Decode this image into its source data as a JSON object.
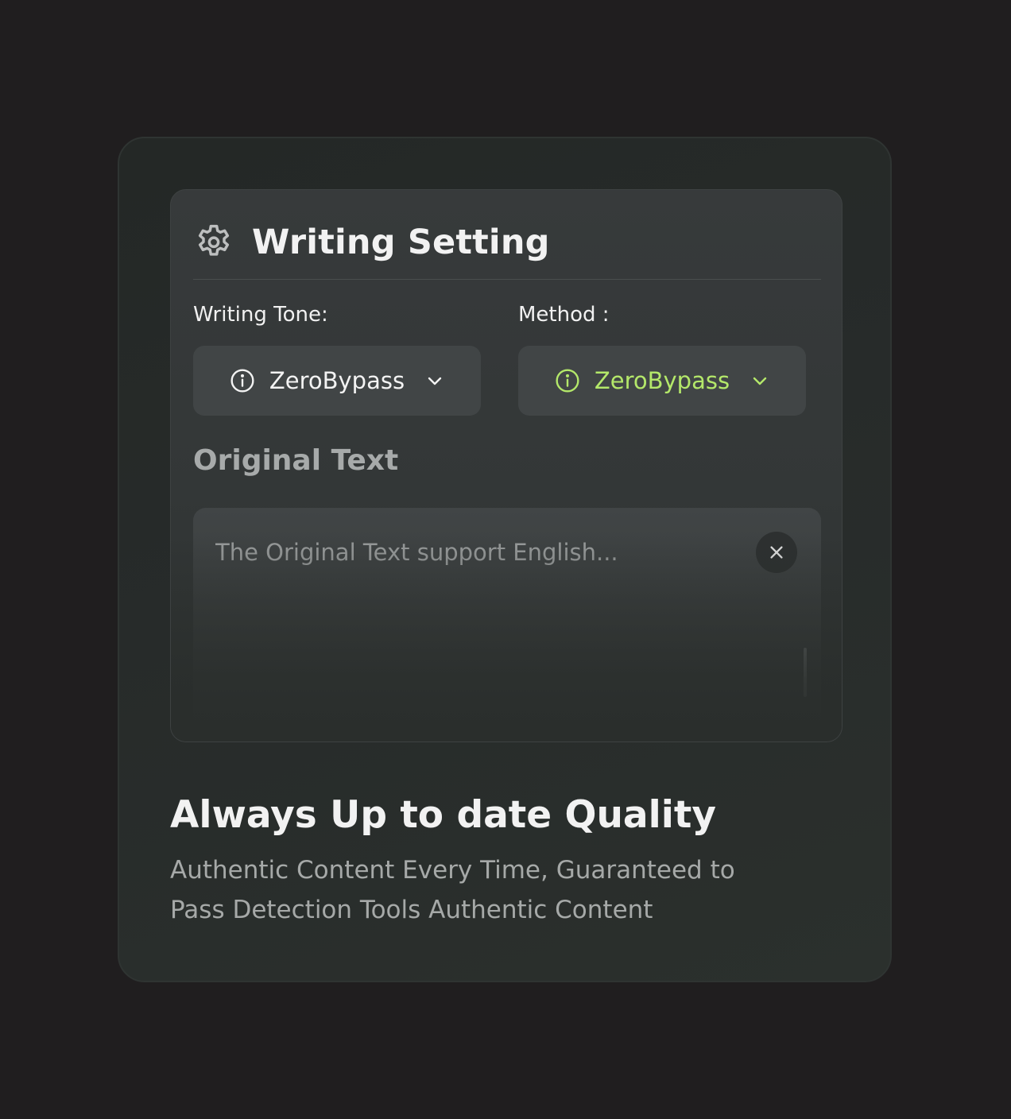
{
  "settings": {
    "title": "Writing Setting",
    "icon": "gear-icon",
    "tone": {
      "label": "Writing Tone:",
      "value": "ZeroBypass",
      "icon": "info-icon",
      "color": "#f3f3f3"
    },
    "method": {
      "label": "Method :",
      "value": "ZeroBypass",
      "icon": "info-icon",
      "color": "#b4e86a"
    }
  },
  "original_text": {
    "title": "Original Text",
    "placeholder": "The Original Text support English...",
    "value": "",
    "clear_icon": "close-icon"
  },
  "feature": {
    "title": "Always Up to date Quality",
    "description": "Authentic Content Every Time, Guaranteed to Pass Detection Tools Authentic Content"
  },
  "colors": {
    "accent": "#b4e86a",
    "background": "#201e1f",
    "card": "#262a28",
    "panel": "#363a3a"
  }
}
